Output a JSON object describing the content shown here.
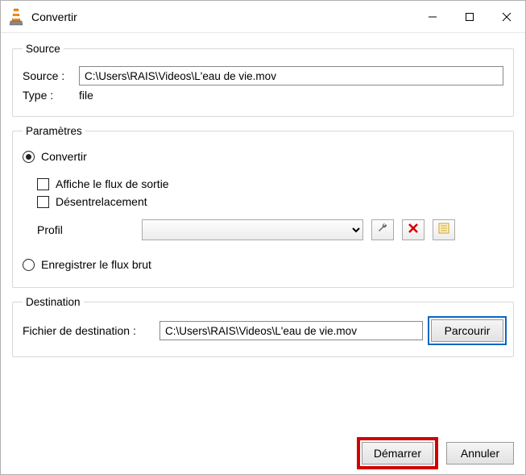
{
  "window": {
    "title": "Convertir"
  },
  "source": {
    "legend": "Source",
    "source_label": "Source :",
    "source_value": "C:\\Users\\RAIS\\Videos\\L'eau de vie.mov",
    "type_label": "Type :",
    "type_value": "file"
  },
  "params": {
    "legend": "Paramètres",
    "radio_convert": "Convertir",
    "chk_show_output": "Affiche le flux de sortie",
    "chk_deinterlace": "Désentrelacement",
    "profil_label": "Profil",
    "profil_value": "",
    "radio_raw": "Enregistrer le flux brut"
  },
  "dest": {
    "legend": "Destination",
    "label": "Fichier de destination :",
    "value": "C:\\Users\\RAIS\\Videos\\L'eau de vie.mov",
    "browse": "Parcourir"
  },
  "footer": {
    "start": "Démarrer",
    "cancel": "Annuler"
  },
  "icons": {
    "wrench": "wrench-icon",
    "delete": "delete-icon",
    "new": "new-profile-icon"
  }
}
